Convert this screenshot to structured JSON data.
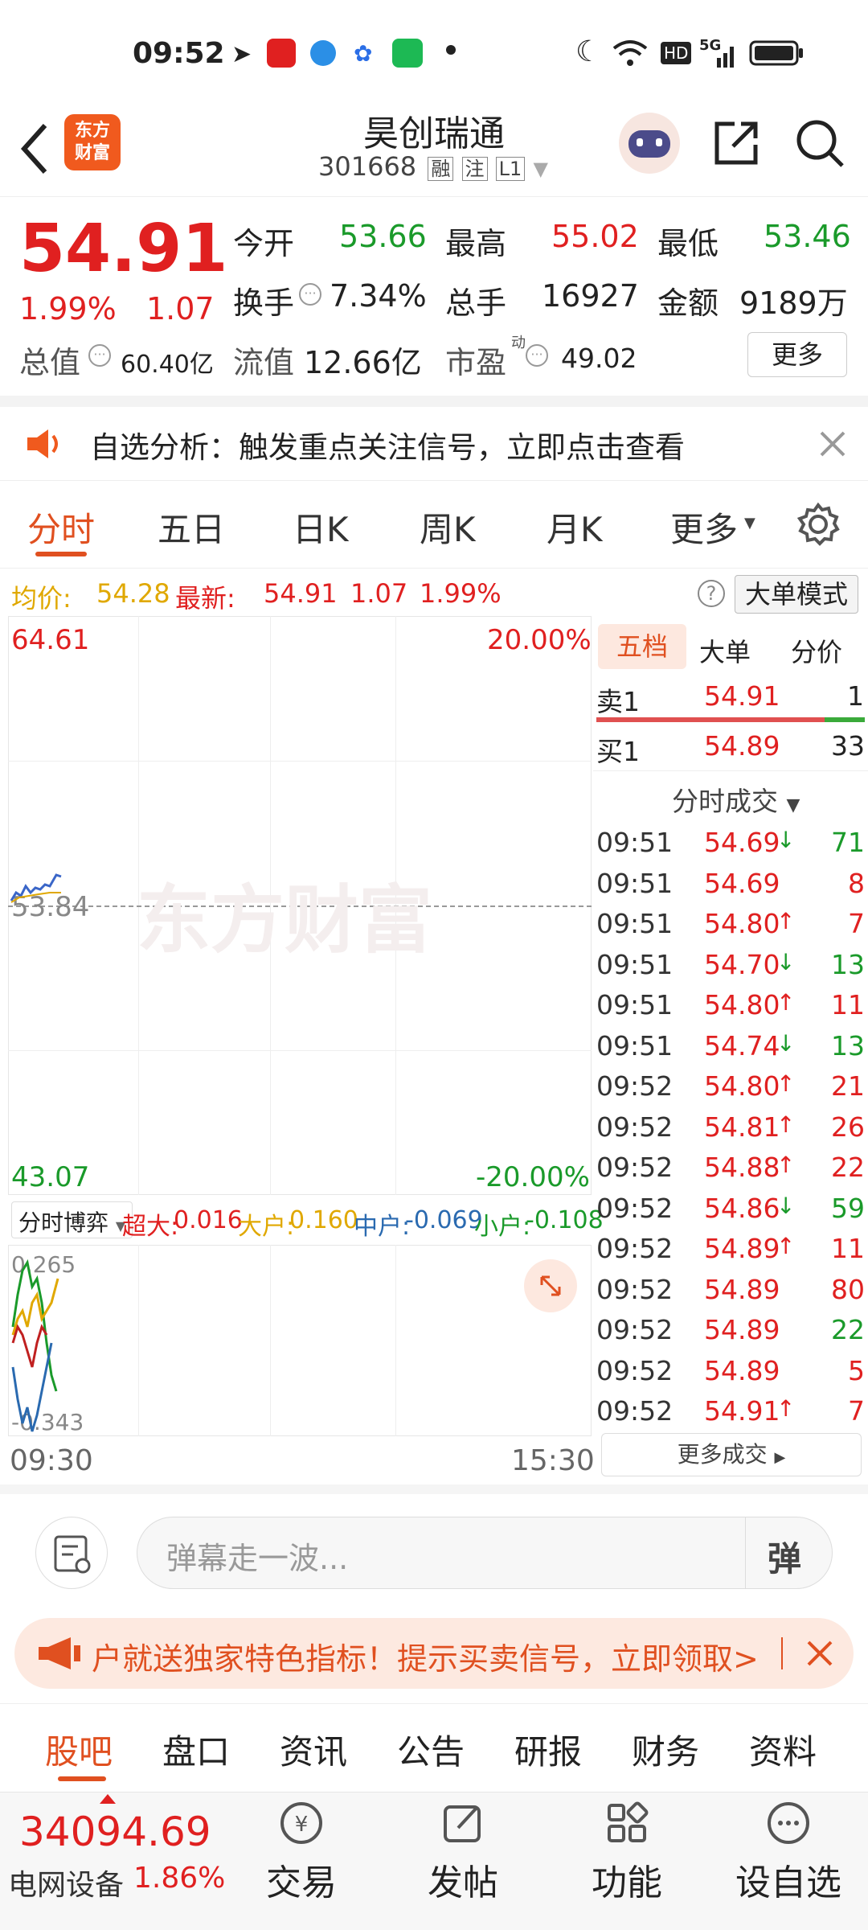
{
  "status": {
    "time": "09:52",
    "hd": "HD",
    "net": "5G"
  },
  "header": {
    "name": "昊创瑞通",
    "code": "301668",
    "tag1": "融",
    "tag2": "注",
    "tag3": "L1",
    "logo_top": "东方",
    "logo_bottom": "财富"
  },
  "quote": {
    "price": "54.91",
    "pct": "1.99%",
    "chg": "1.07",
    "open_label": "今开",
    "open": "53.66",
    "high_label": "最高",
    "high": "55.02",
    "low_label": "最低",
    "low": "53.46",
    "turnover_label": "换手",
    "turnover": "7.34%",
    "vol_label": "总手",
    "vol": "16927",
    "amount_label": "金额",
    "amount": "9189万",
    "mcap_label": "总值",
    "mcap": "60.40亿",
    "float_label": "流值",
    "float": "12.66亿",
    "pe_label": "市盈",
    "pe_sup": "动",
    "pe": "49.02",
    "more": "更多"
  },
  "notice": {
    "text": "自选分析：触发重点关注信号，立即点击查看"
  },
  "tabs": [
    "分时",
    "五日",
    "日K",
    "周K",
    "月K",
    "更多"
  ],
  "info": {
    "avg_label": "均价:",
    "avg": "54.28",
    "last_label": "最新:",
    "last": "54.91",
    "chg": "1.07",
    "pct": "1.99%",
    "mode": "大单模式"
  },
  "chart": {
    "top_price": "64.61",
    "top_pct": "20.00%",
    "mid_price": "53.84",
    "bot_price": "43.07",
    "bot_pct": "-20.00%",
    "start": "09:30",
    "end": "15:30",
    "watermark": "东方财富"
  },
  "flow": {
    "select": "分时博弈",
    "super_label": "超大:",
    "super": "0.016",
    "big_label": "大户:",
    "big": "0.160",
    "mid_label": "中户:",
    "mid": "-0.069",
    "small_label": "小户:",
    "small": "-0.108",
    "max": "0.265",
    "min": "-0.343"
  },
  "side": {
    "tabs": [
      "五档",
      "大单",
      "分价"
    ],
    "sell1_label": "卖1",
    "sell1_price": "54.91",
    "sell1_vol": "1",
    "buy1_label": "买1",
    "buy1_price": "54.89",
    "buy1_vol": "33",
    "trades_title": "分时成交",
    "trades": [
      {
        "t": "09:51",
        "p": "54.69",
        "d": "↓",
        "v": "71"
      },
      {
        "t": "09:51",
        "p": "54.69",
        "d": "",
        "v": "8"
      },
      {
        "t": "09:51",
        "p": "54.80",
        "d": "↑",
        "v": "7"
      },
      {
        "t": "09:51",
        "p": "54.70",
        "d": "↓",
        "v": "13"
      },
      {
        "t": "09:51",
        "p": "54.80",
        "d": "↑",
        "v": "11"
      },
      {
        "t": "09:51",
        "p": "54.74",
        "d": "↓",
        "v": "13"
      },
      {
        "t": "09:52",
        "p": "54.80",
        "d": "↑",
        "v": "21"
      },
      {
        "t": "09:52",
        "p": "54.81",
        "d": "↑",
        "v": "26"
      },
      {
        "t": "09:52",
        "p": "54.88",
        "d": "↑",
        "v": "22"
      },
      {
        "t": "09:52",
        "p": "54.86",
        "d": "↓",
        "v": "59"
      },
      {
        "t": "09:52",
        "p": "54.89",
        "d": "↑",
        "v": "11"
      },
      {
        "t": "09:52",
        "p": "54.89",
        "d": "",
        "v": "80"
      },
      {
        "t": "09:52",
        "p": "54.89",
        "d": "",
        "v": "22"
      },
      {
        "t": "09:52",
        "p": "54.89",
        "d": "",
        "v": "5"
      },
      {
        "t": "09:52",
        "p": "54.91",
        "d": "↑",
        "v": "7"
      }
    ],
    "more_trades": "更多成交"
  },
  "comment": {
    "placeholder": "弹幕走一波...",
    "danmaku": "弹"
  },
  "promo": {
    "text": "户就送独家特色指标！提示买卖信号，立即领取>"
  },
  "bottom_tabs": [
    "股吧",
    "盘口",
    "资讯",
    "公告",
    "研报",
    "财务",
    "资料"
  ],
  "footer": {
    "index_value": "34094.69",
    "index_name": "电网设备",
    "index_pct": "1.86%",
    "trade": "交易",
    "post": "发帖",
    "func": "功能",
    "watch": "设自选"
  }
}
